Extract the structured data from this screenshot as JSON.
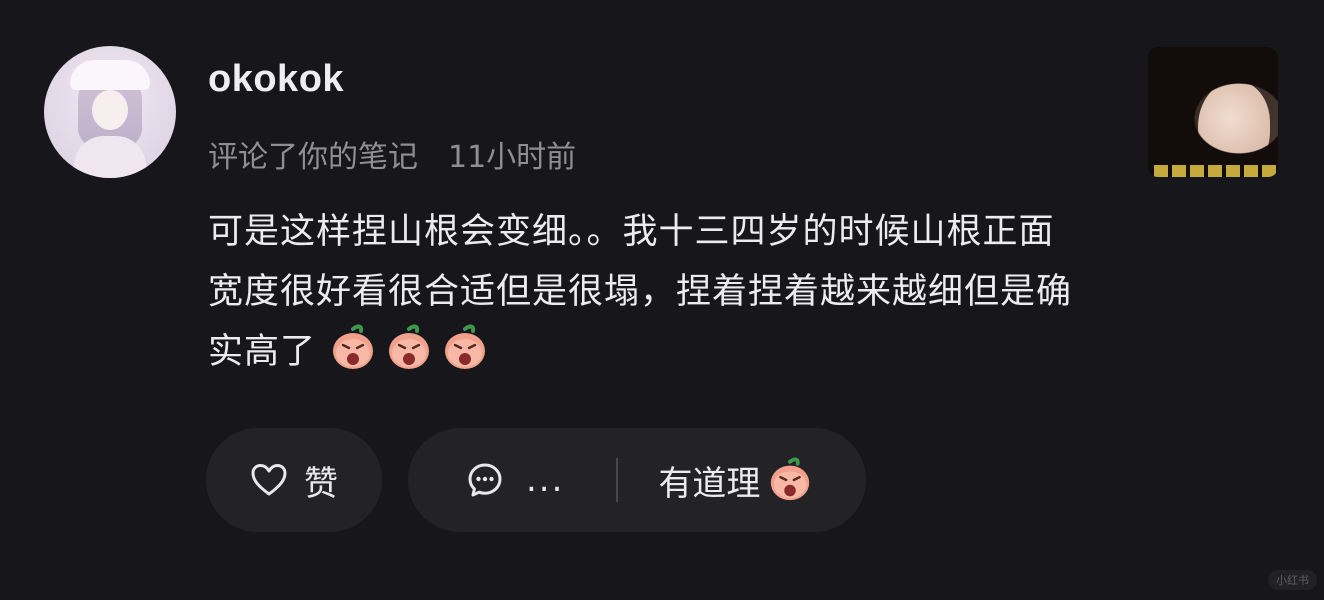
{
  "user": {
    "name": "okokok",
    "action": "评论了你的笔记",
    "time": "11小时前"
  },
  "comment": {
    "text": "可是这样捏山根会变细。。我十三四岁的时候山根正面宽度很好看很合适但是很塌，捏着捏着越来越细但是确实高了",
    "emoji_count": 3,
    "emoji_name": "crying-peach-emoji"
  },
  "actions": {
    "like_label": "赞",
    "more_label": "...",
    "quick_reply": "有道理"
  },
  "watermark": "小红书",
  "colors": {
    "background": "#17171b",
    "pill": "#232327",
    "muted_text": "#8e8e93",
    "peach": "#f2a08c"
  }
}
